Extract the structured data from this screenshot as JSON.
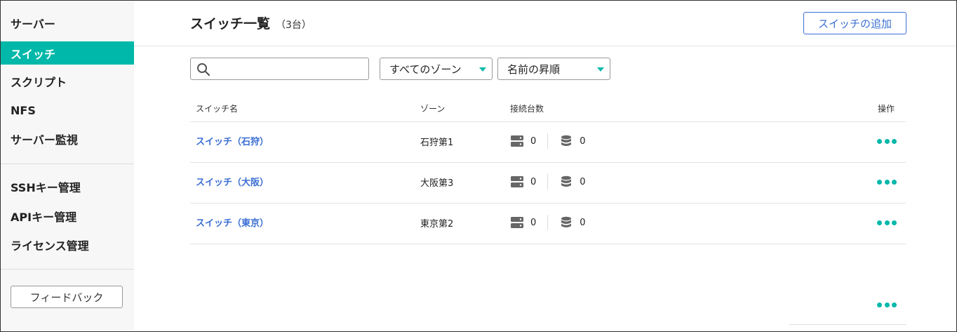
{
  "sidebar": {
    "items": [
      {
        "label": "サーバー",
        "active": false
      },
      {
        "label": "スイッチ",
        "active": true
      },
      {
        "label": "スクリプト",
        "active": false
      },
      {
        "label": "NFS",
        "active": false
      },
      {
        "label": "サーバー監視",
        "active": false
      },
      {
        "label": "SSHキー管理",
        "active": false
      },
      {
        "label": "APIキー管理",
        "active": false
      },
      {
        "label": "ライセンス管理",
        "active": false
      }
    ],
    "feedback_label": "フィードバック"
  },
  "header": {
    "title": "スイッチ一覧",
    "count": "（3台）",
    "add_button_label": "スイッチの追加"
  },
  "filters": {
    "search_value": "",
    "search_placeholder": "",
    "zone_select": "すべてのゾーン",
    "sort_select": "名前の昇順"
  },
  "table": {
    "columns": {
      "name": "スイッチ名",
      "zone": "ゾーン",
      "connections": "接続台数",
      "actions": "操作"
    },
    "rows": [
      {
        "name": "スイッチ（石狩）",
        "zone": "石狩第1",
        "servers": "0",
        "storages": "0"
      },
      {
        "name": "スイッチ（大阪）",
        "zone": "大阪第3",
        "servers": "0",
        "storages": "0"
      },
      {
        "name": "スイッチ（東京）",
        "zone": "東京第2",
        "servers": "0",
        "storages": "0"
      }
    ]
  },
  "icons": {
    "search": "search-icon",
    "server": "server-icon",
    "storage": "database-icon",
    "more": "more-horizontal-icon",
    "caret": "caret-down-icon"
  },
  "colors": {
    "accent": "#00b8a9",
    "link": "#3b6fd4"
  }
}
